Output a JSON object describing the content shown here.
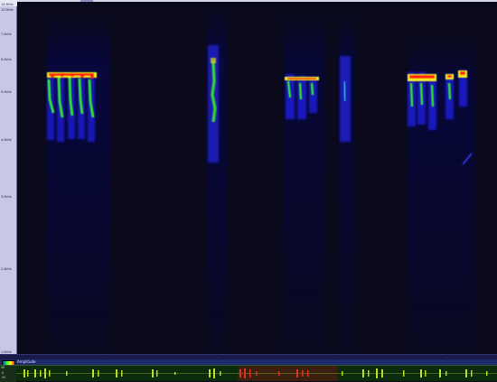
{
  "frequency_axis": {
    "ticks": [
      "14.9kHz",
      "12.9kHz",
      "7.0kHz",
      "6.0kHz",
      "5.0kHz",
      "4.0kHz",
      "3.0kHz",
      "2.0kHz",
      "1.0kHz"
    ]
  },
  "toolbar": {
    "label": "Amplitude"
  },
  "overview_axis": {
    "labels": [
      "dB",
      "-6",
      "-99"
    ]
  },
  "colors": {
    "background": "#0a0a1c",
    "ruler": "#c8c8e4",
    "low": "#1818c0",
    "mid": "#20e020",
    "high": "#ff2010",
    "waveform": "#b8e020",
    "selection": "#8a1414"
  },
  "icons": {
    "palette": "color-scale-icon"
  }
}
